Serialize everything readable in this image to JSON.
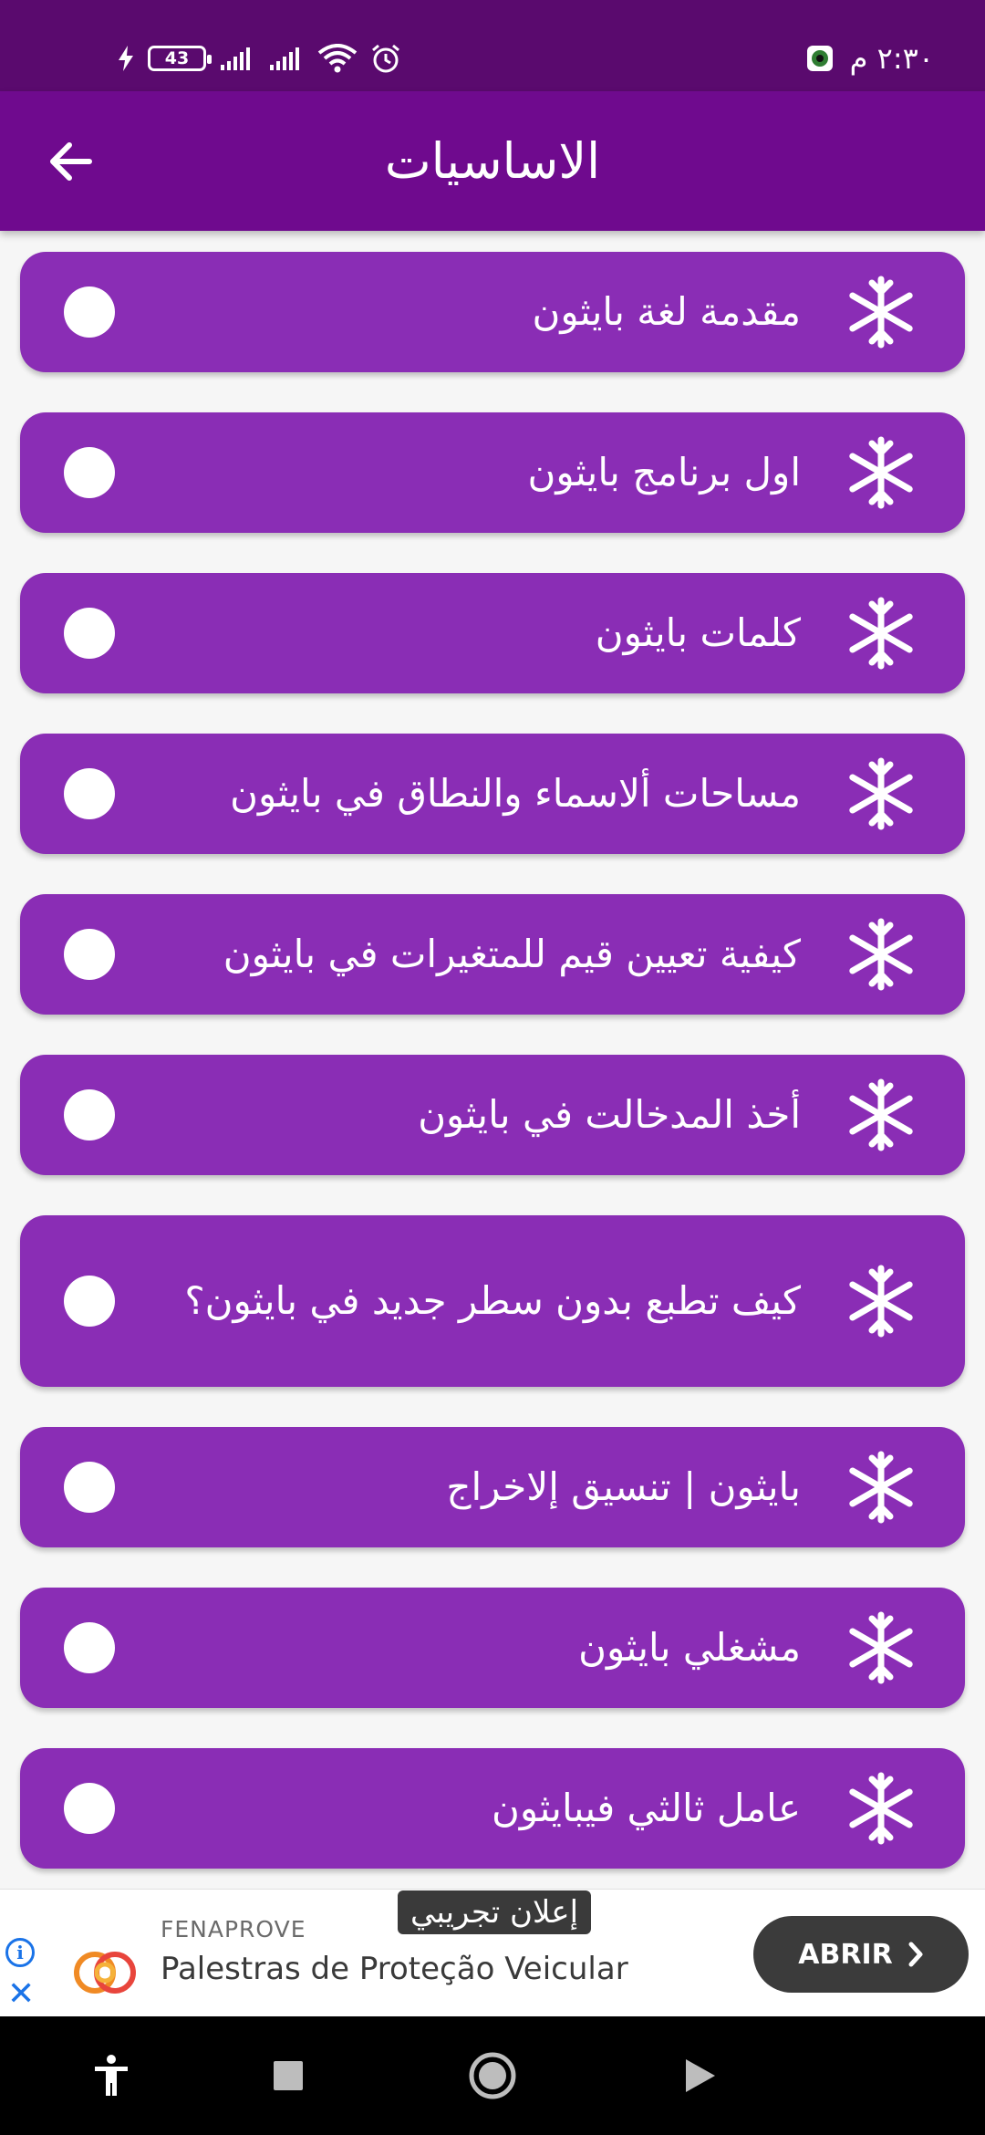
{
  "status_bar": {
    "time": "٢:٣٠ م",
    "battery_level": "43",
    "bg_color": "#5a0a6e"
  },
  "app_bar": {
    "title": "الاساسيات",
    "back_icon": "arrow-left-icon",
    "bg_color": "#6f0a8e"
  },
  "lessons": [
    {
      "label": "مقدمة لغة بايثون"
    },
    {
      "label": "اول برنامج بايثون"
    },
    {
      "label": "كلمات بايثون"
    },
    {
      "label": "مساحات ألاسماء والنطاق في بايثون"
    },
    {
      "label": "كيفية تعيين قيم للمتغيرات في بايثون"
    },
    {
      "label": "أخذ المدخالت في بايثون"
    },
    {
      "label": "كيف تطبع بدون سطر جديد في بايثون؟"
    },
    {
      "label": "بايثون | تنسيق إلاخراج"
    },
    {
      "label": "مشغلي بايثون"
    },
    {
      "label": "عامل ثالثي فيبايثون"
    }
  ],
  "card_color": "#8a2db5",
  "ad": {
    "tag": "إعلان تجريبي",
    "brand": "FENAPROVE",
    "headline": "Palestras de Proteção Veicular",
    "cta": "ABRIR"
  }
}
